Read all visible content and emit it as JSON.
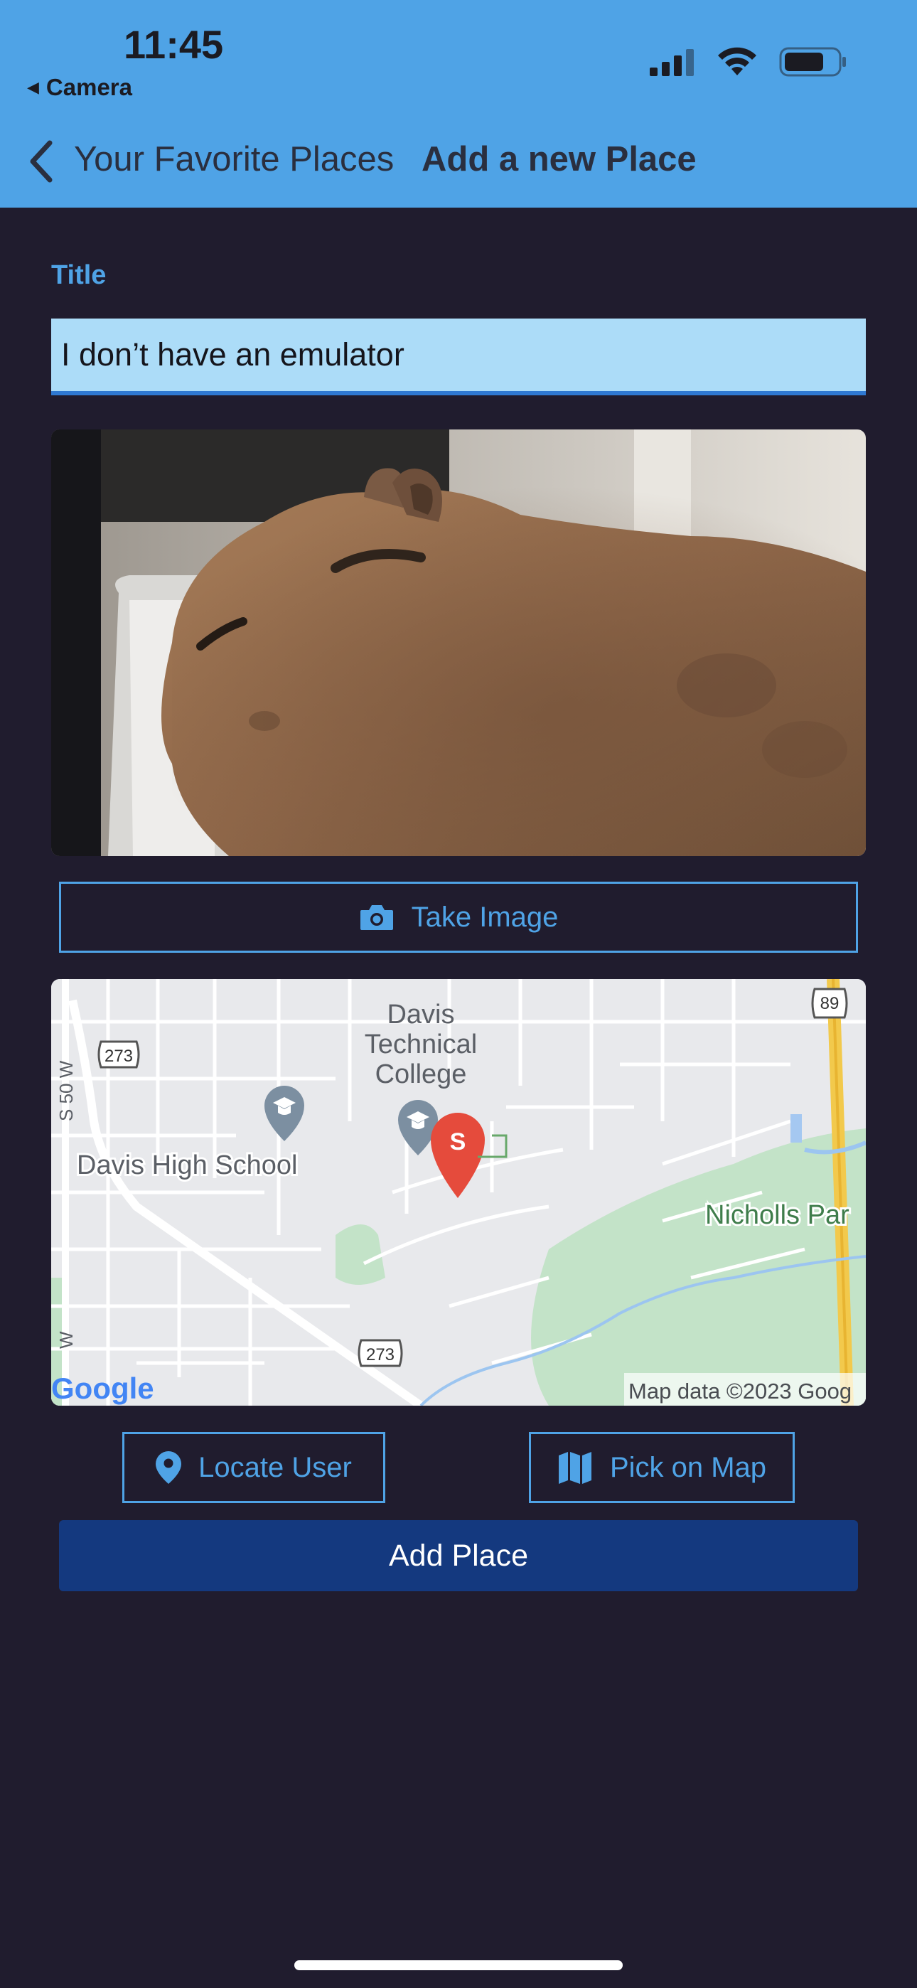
{
  "status_bar": {
    "time": "11:45",
    "back_app_label": "Camera"
  },
  "nav": {
    "back_label": "Your Favorite Places",
    "title": "Add a new Place"
  },
  "form": {
    "title_label": "Title",
    "title_value": "I don’t have an emulator"
  },
  "buttons": {
    "take_image": "Take Image",
    "locate_user": "Locate User",
    "pick_on_map": "Pick on Map",
    "add_place": "Add Place"
  },
  "map": {
    "labels": {
      "college_line1": "Davis",
      "college_line2": "Technical",
      "college_line3": "College",
      "high_school": "Davis High School",
      "park": "Nicholls Par",
      "road_s50w": "S 50 W",
      "road_w": "W",
      "route_273_top": "273",
      "route_273_bottom": "273",
      "route_89": "89",
      "pin_letter": "S",
      "google": "Google",
      "attribution": "Map data ©2023 Goog"
    }
  },
  "icons": {
    "camera": "camera-icon",
    "location": "location-pin-icon",
    "map": "map-icon",
    "back": "chevron-left-icon"
  },
  "colors": {
    "background": "#201c2e",
    "header": "#4fa3e6",
    "accent": "#4fa3e6",
    "input_bg": "#acdcf8",
    "primary_button": "#14397f"
  }
}
